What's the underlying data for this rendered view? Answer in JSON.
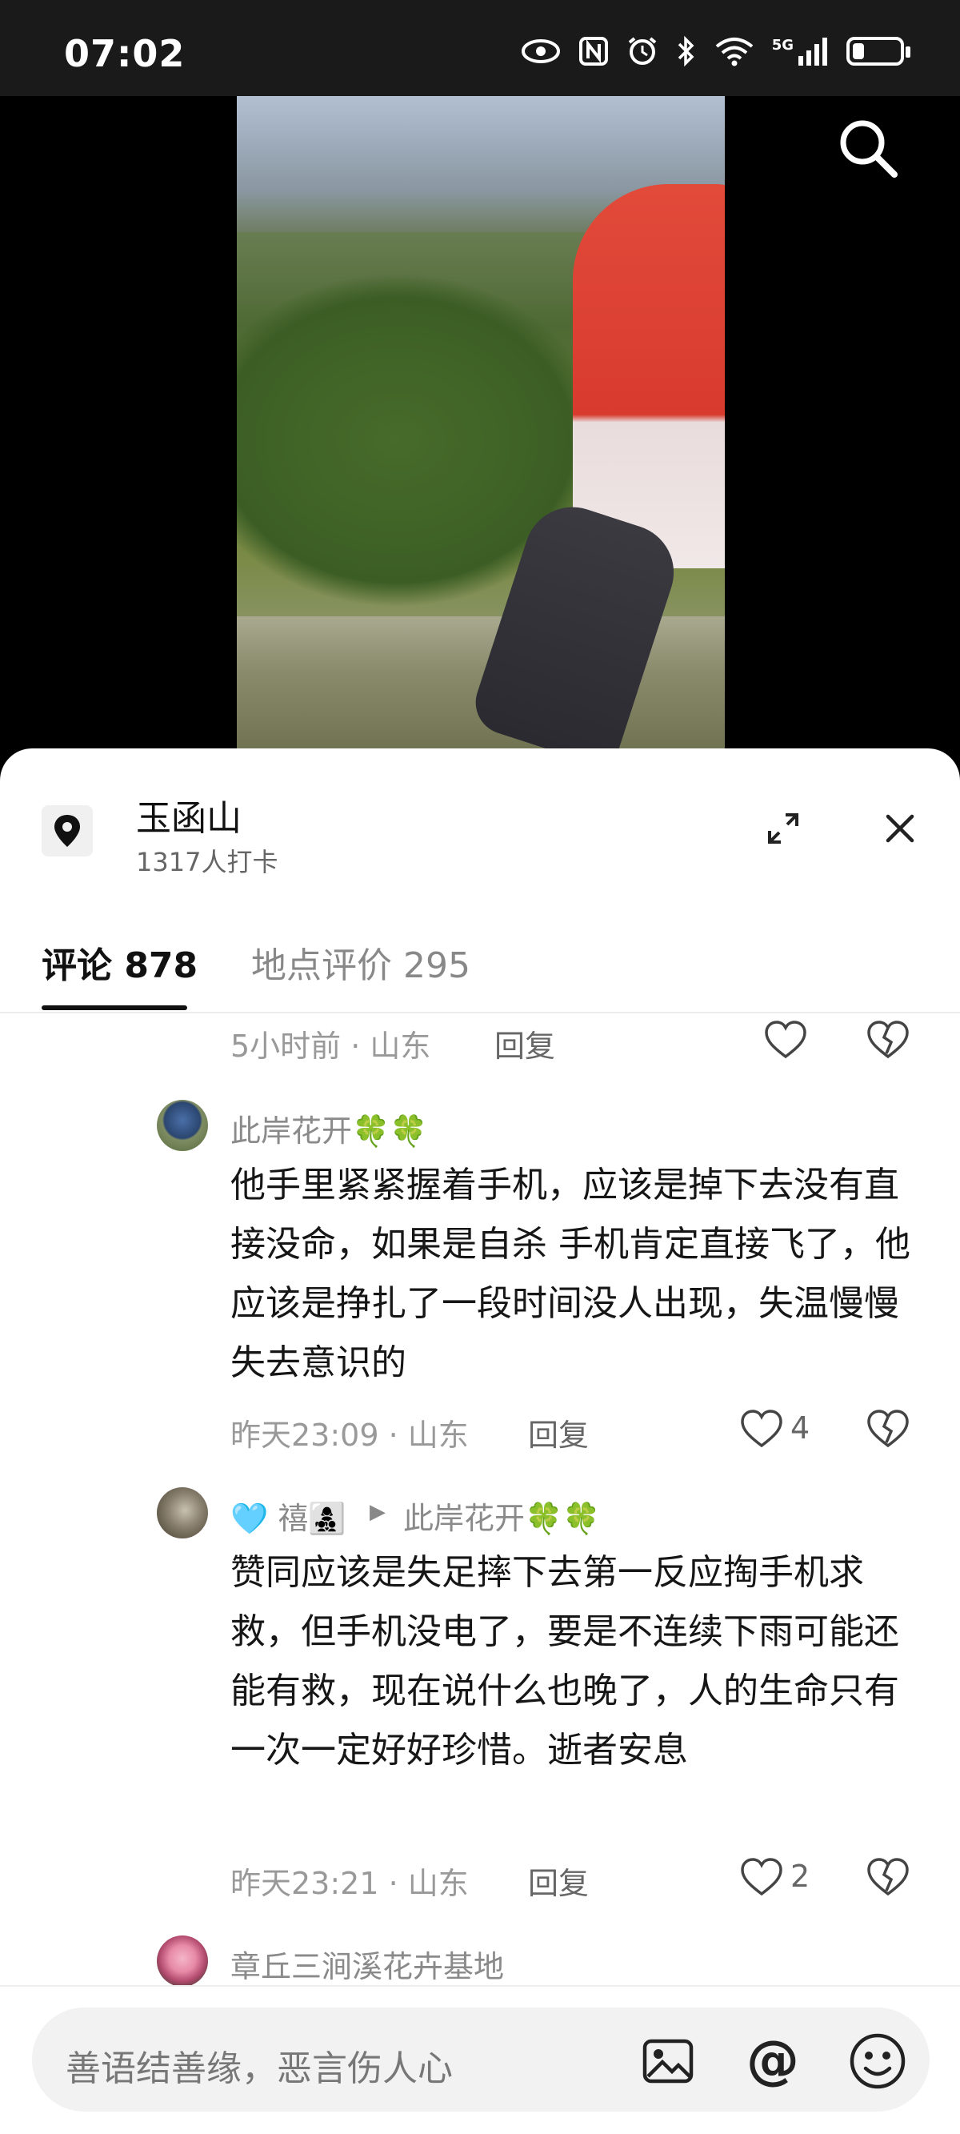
{
  "status_bar": {
    "time": "07:02",
    "icons": [
      "eye-icon",
      "nfc-icon",
      "alarm-icon",
      "bluetooth-icon",
      "wifi-icon",
      "5g-signal-icon",
      "battery-icon"
    ],
    "network_label": "5G",
    "battery_level": 0.25
  },
  "location": {
    "name": "玉函山",
    "checkins": "1317人打卡"
  },
  "tabs": [
    {
      "label": "评论 878",
      "active": true
    },
    {
      "label": "地点评价 295",
      "active": false
    }
  ],
  "comments": [
    {
      "meta": "5小时前 · 山东",
      "reply_label": "回复"
    },
    {
      "user": "此岸花开🍀🍀",
      "text": "他手里紧紧握着手机，应该是掉下去没有直接没命，如果是自杀  手机肯定直接飞了，他应该是挣扎了一段时间没人出现，失温慢慢失去意识的",
      "meta": "昨天23:09 · 山东",
      "reply_label": "回复",
      "likes": "4"
    },
    {
      "user": "🩵 禧👩‍👧‍👦",
      "reply_to_arrow": "▶",
      "reply_to": "此岸花开🍀🍀",
      "text": "赞同应该是失足摔下去第一反应掏手机求救，但手机没电了，要是不连续下雨可能还能有救，现在说什么也晚了，人的生命只有一次一定好好珍惜。逝者安息",
      "meta": "昨天23:21 · 山东",
      "reply_label": "回复",
      "likes": "2"
    },
    {
      "user": "章丘三涧溪花卉基地"
    }
  ],
  "input": {
    "placeholder": "善语结善缘，恶言伤人心",
    "at_label": "@"
  }
}
